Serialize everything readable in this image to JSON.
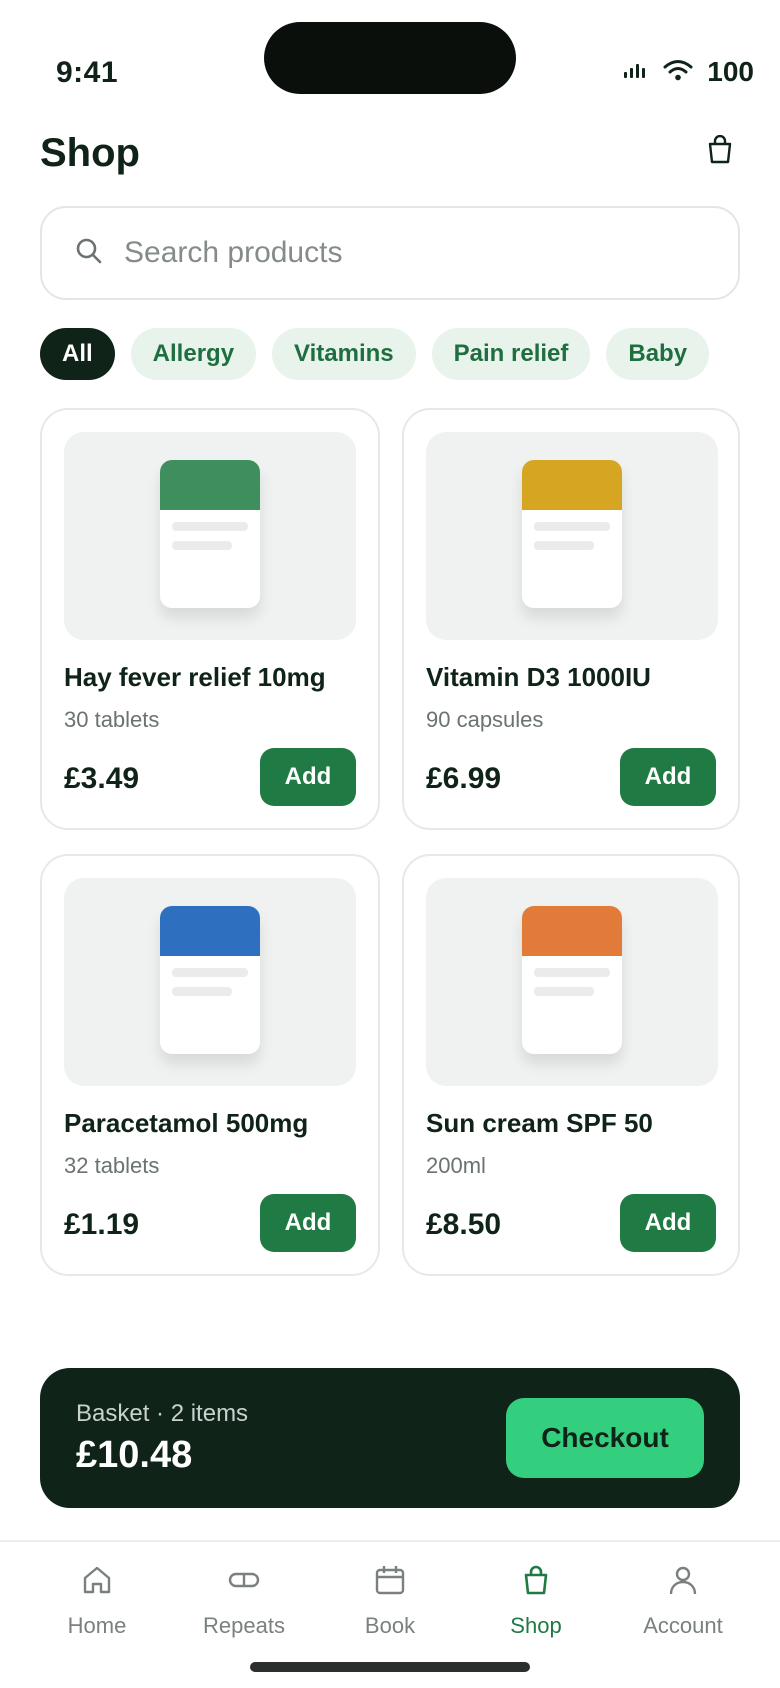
{
  "status_bar": {
    "time": "9:41",
    "battery": "100"
  },
  "header": {
    "title": "Shop",
    "bag_icon": "shopping-bag-icon"
  },
  "search": {
    "placeholder": "Search products",
    "value": ""
  },
  "filters": [
    {
      "label": "All",
      "active": true
    },
    {
      "label": "Allergy",
      "active": false
    },
    {
      "label": "Vitamins",
      "active": false
    },
    {
      "label": "Pain relief",
      "active": false
    },
    {
      "label": "Baby",
      "active": false
    }
  ],
  "products": [
    {
      "name": "Hay fever relief 10mg",
      "desc": "30 tablets",
      "price": "£3.49",
      "add_label": "Add",
      "color": "#3f8f5e"
    },
    {
      "name": "Vitamin D3 1000IU",
      "desc": "90 capsules",
      "price": "£6.99",
      "add_label": "Add",
      "color": "#d6a622"
    },
    {
      "name": "Paracetamol 500mg",
      "desc": "32 tablets",
      "price": "£1.19",
      "add_label": "Add",
      "color": "#2f6fbf"
    },
    {
      "name": "Sun cream SPF 50",
      "desc": "200ml",
      "price": "£8.50",
      "add_label": "Add",
      "color": "#e27b3a"
    }
  ],
  "basket": {
    "label": "Basket · 2 items",
    "total": "£10.48",
    "checkout_label": "Checkout"
  },
  "tabs": [
    {
      "label": "Home",
      "icon": "home-icon"
    },
    {
      "label": "Repeats",
      "icon": "pill-icon"
    },
    {
      "label": "Book",
      "icon": "calendar-icon"
    },
    {
      "label": "Shop",
      "icon": "shopping-bag-icon",
      "active": true
    },
    {
      "label": "Account",
      "icon": "person-icon"
    }
  ],
  "colors": {
    "primary": "#1f7a44",
    "dark": "#0f2318",
    "accent": "#34cf7e",
    "chip_bg": "#e8f3ec"
  }
}
